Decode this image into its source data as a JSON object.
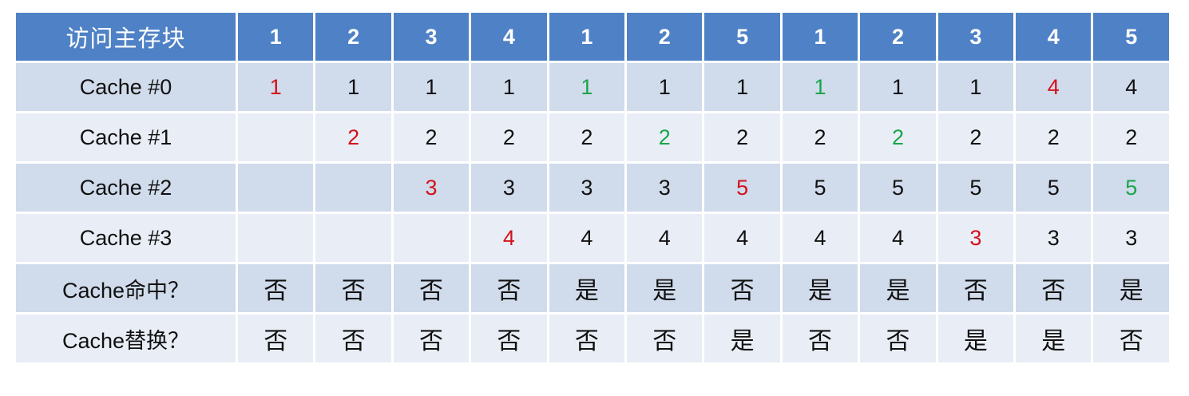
{
  "header": {
    "label": "访问主存块",
    "blocks": [
      "1",
      "2",
      "3",
      "4",
      "1",
      "2",
      "5",
      "1",
      "2",
      "3",
      "4",
      "5"
    ]
  },
  "colors": {
    "header_bg": "#4f81c6",
    "row_dark": "#d0dbeb",
    "row_light": "#e9eef6",
    "miss_load": "#d4111b",
    "hit": "#19a64a"
  },
  "rows": [
    {
      "label": "Cache #0",
      "cells": [
        {
          "v": "1",
          "c": "red"
        },
        {
          "v": "1"
        },
        {
          "v": "1"
        },
        {
          "v": "1"
        },
        {
          "v": "1",
          "c": "green"
        },
        {
          "v": "1"
        },
        {
          "v": "1"
        },
        {
          "v": "1",
          "c": "green"
        },
        {
          "v": "1"
        },
        {
          "v": "1"
        },
        {
          "v": "4",
          "c": "red"
        },
        {
          "v": "4"
        }
      ]
    },
    {
      "label": "Cache #1",
      "cells": [
        {
          "v": ""
        },
        {
          "v": "2",
          "c": "red"
        },
        {
          "v": "2"
        },
        {
          "v": "2"
        },
        {
          "v": "2"
        },
        {
          "v": "2",
          "c": "green"
        },
        {
          "v": "2"
        },
        {
          "v": "2"
        },
        {
          "v": "2",
          "c": "green"
        },
        {
          "v": "2"
        },
        {
          "v": "2"
        },
        {
          "v": "2"
        }
      ]
    },
    {
      "label": "Cache #2",
      "cells": [
        {
          "v": ""
        },
        {
          "v": ""
        },
        {
          "v": "3",
          "c": "red"
        },
        {
          "v": "3"
        },
        {
          "v": "3"
        },
        {
          "v": "3"
        },
        {
          "v": "5",
          "c": "red"
        },
        {
          "v": "5"
        },
        {
          "v": "5"
        },
        {
          "v": "5"
        },
        {
          "v": "5"
        },
        {
          "v": "5",
          "c": "green"
        }
      ]
    },
    {
      "label": "Cache #3",
      "cells": [
        {
          "v": ""
        },
        {
          "v": ""
        },
        {
          "v": ""
        },
        {
          "v": "4",
          "c": "red"
        },
        {
          "v": "4"
        },
        {
          "v": "4"
        },
        {
          "v": "4"
        },
        {
          "v": "4"
        },
        {
          "v": "4"
        },
        {
          "v": "3",
          "c": "red"
        },
        {
          "v": "3"
        },
        {
          "v": "3"
        }
      ]
    },
    {
      "label": "Cache命中？",
      "zh": true,
      "cells": [
        {
          "v": "否"
        },
        {
          "v": "否"
        },
        {
          "v": "否"
        },
        {
          "v": "否"
        },
        {
          "v": "是"
        },
        {
          "v": "是"
        },
        {
          "v": "否"
        },
        {
          "v": "是"
        },
        {
          "v": "是"
        },
        {
          "v": "否"
        },
        {
          "v": "否"
        },
        {
          "v": "是"
        }
      ]
    },
    {
      "label": "Cache替换？",
      "zh": true,
      "cells": [
        {
          "v": "否"
        },
        {
          "v": "否"
        },
        {
          "v": "否"
        },
        {
          "v": "否"
        },
        {
          "v": "否"
        },
        {
          "v": "否"
        },
        {
          "v": "是"
        },
        {
          "v": "否"
        },
        {
          "v": "否"
        },
        {
          "v": "是"
        },
        {
          "v": "是"
        },
        {
          "v": "否"
        }
      ]
    }
  ]
}
